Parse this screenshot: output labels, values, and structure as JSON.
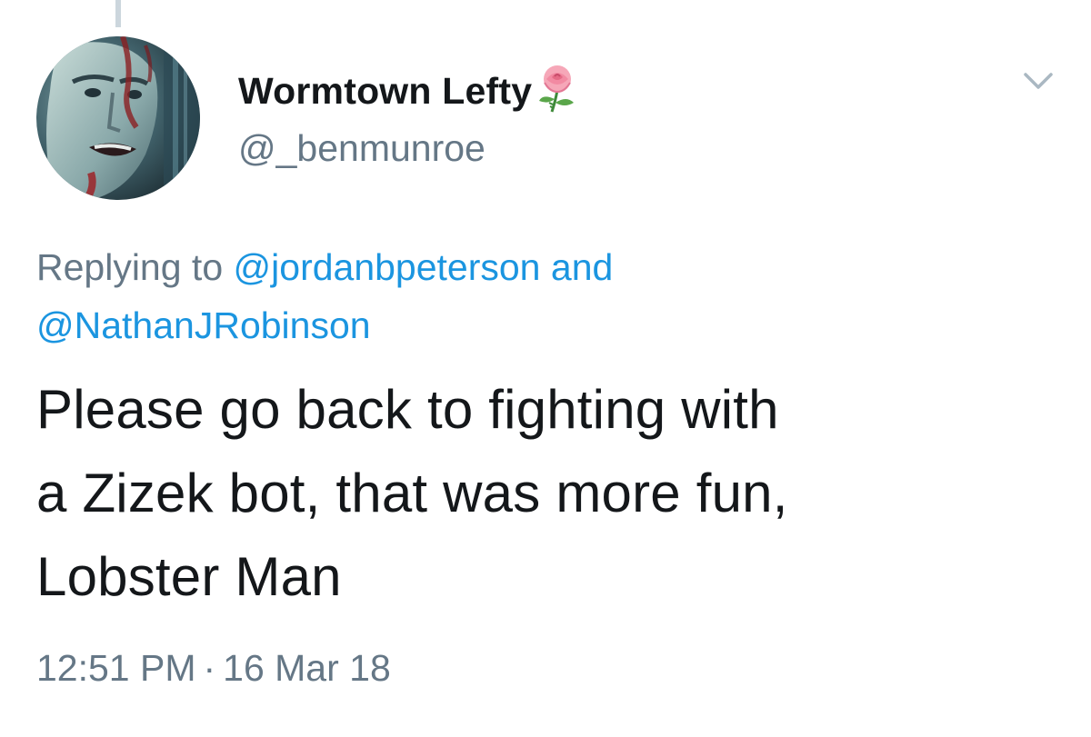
{
  "tweet": {
    "author": {
      "display_name": "Wormtown Lefty",
      "name_emoji": "rose-icon",
      "handle": "@_benmunroe",
      "avatar": "avatar"
    },
    "menu_icon": "chevron-down-icon",
    "reply_context": {
      "prefix": "Replying to",
      "mention_1": "@jordanbpeterson",
      "conjunction": "and",
      "mention_2": "@NathanJRobinson"
    },
    "text_lines": [
      "Please go back to fighting with",
      "a Zizek bot, that was more fun,",
      "Lobster Man"
    ],
    "time": "12:51 PM",
    "separator": "·",
    "date": "16 Mar 18"
  },
  "colors": {
    "primary_text": "#14171a",
    "secondary_text": "#657786",
    "link": "#1b95e0",
    "thread_line": "#ccd6dd"
  }
}
